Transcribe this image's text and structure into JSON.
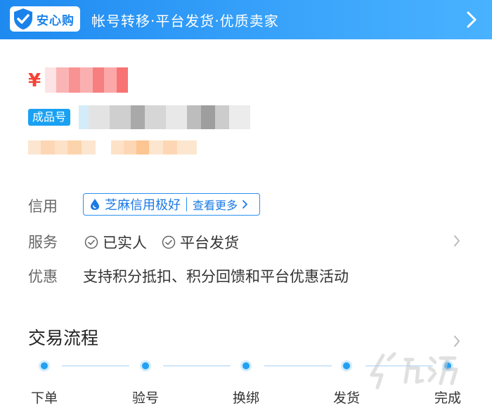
{
  "banner": {
    "badge_text": "安心购",
    "slogan": "帐号转移·平台发货·优质卖家"
  },
  "price": {
    "symbol": "¥"
  },
  "product": {
    "tag": "成品号"
  },
  "info": {
    "credit_label": "信用",
    "credit_text": "芝麻信用极好",
    "credit_more": "查看更多",
    "service_label": "服务",
    "services": [
      "已实人",
      "平台发货"
    ],
    "promo_label": "优惠",
    "promo_text": "支持积分抵扣、积分回馈和平台优惠活动"
  },
  "flow": {
    "title": "交易流程",
    "steps": [
      "下单",
      "验号",
      "换绑",
      "发货",
      "完成"
    ]
  },
  "colors": {
    "brand_blue": "#1e8af0",
    "price_red": "#f44336",
    "dot_blue": "#22a0f3"
  }
}
